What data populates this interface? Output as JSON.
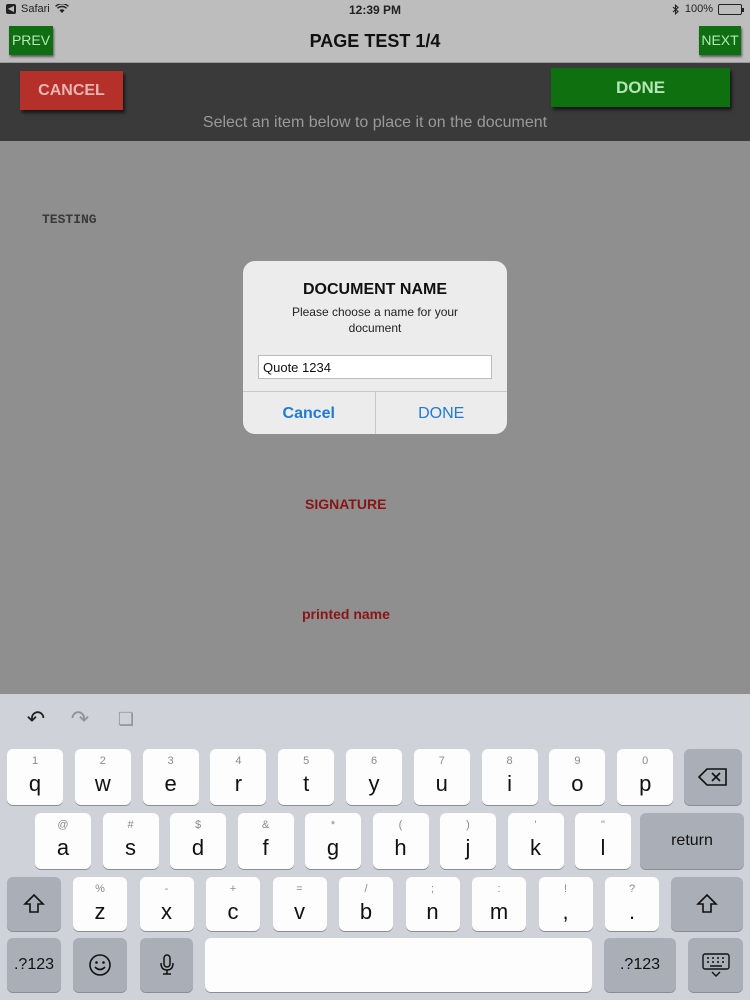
{
  "status_bar": {
    "carrier": "Safari",
    "time": "12:39 PM",
    "battery_percent": "100%",
    "battery_level": 1.0
  },
  "title_bar": {
    "prev_label": "PREV",
    "title": "PAGE TEST 1/4",
    "next_label": "NEXT"
  },
  "action_bar": {
    "cancel_label": "CANCEL",
    "done_label": "DONE",
    "instruction": "Select an item below to place it on the document"
  },
  "document": {
    "text_testing": "TESTING",
    "signature_label": "SIGNATURE",
    "printed_name_label": "printed name"
  },
  "dialog": {
    "title": "DOCUMENT NAME",
    "message": "Please choose a name for your document",
    "input_value": "Quote 1234",
    "cancel_label": "Cancel",
    "done_label": "DONE"
  },
  "keyboard": {
    "row1": [
      {
        "alt": "1",
        "main": "q"
      },
      {
        "alt": "2",
        "main": "w"
      },
      {
        "alt": "3",
        "main": "e"
      },
      {
        "alt": "4",
        "main": "r"
      },
      {
        "alt": "5",
        "main": "t"
      },
      {
        "alt": "6",
        "main": "y"
      },
      {
        "alt": "7",
        "main": "u"
      },
      {
        "alt": "8",
        "main": "i"
      },
      {
        "alt": "9",
        "main": "o"
      },
      {
        "alt": "0",
        "main": "p"
      }
    ],
    "row2": [
      {
        "alt": "@",
        "main": "a"
      },
      {
        "alt": "#",
        "main": "s"
      },
      {
        "alt": "$",
        "main": "d"
      },
      {
        "alt": "&",
        "main": "f"
      },
      {
        "alt": "*",
        "main": "g"
      },
      {
        "alt": "(",
        "main": "h"
      },
      {
        "alt": ")",
        "main": "j"
      },
      {
        "alt": "'",
        "main": "k"
      },
      {
        "alt": "\"",
        "main": "l"
      }
    ],
    "row3": [
      {
        "alt": "%",
        "main": "z"
      },
      {
        "alt": "-",
        "main": "x"
      },
      {
        "alt": "+",
        "main": "c"
      },
      {
        "alt": "=",
        "main": "v"
      },
      {
        "alt": "/",
        "main": "b"
      },
      {
        "alt": ";",
        "main": "n"
      },
      {
        "alt": ":",
        "main": "m"
      },
      {
        "alt": "!",
        "main": ","
      },
      {
        "alt": "?",
        "main": "."
      }
    ],
    "return_label": "return",
    "numbers_left_label": ".?123",
    "numbers_right_label": ".?123"
  }
}
